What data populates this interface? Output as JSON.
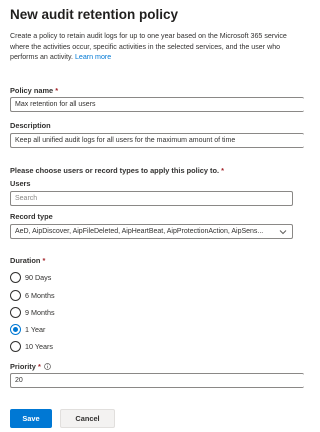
{
  "panel": {
    "title": "New audit retention policy",
    "description": "Create a policy to retain audit logs for up to one year based on the Microsoft 365 service where the activities occur, specific activities in the selected services, and the user who performs an activity.",
    "learn_more": "Learn more"
  },
  "form": {
    "policy_name": {
      "label": "Policy name",
      "required_mark": "*",
      "value": "Max retention for all users"
    },
    "description": {
      "label": "Description",
      "value": "Keep all unified audit logs for all users for the maximum amount of time"
    },
    "scope_heading": "Please choose users or record types to apply this policy to.",
    "scope_required_mark": "*",
    "users": {
      "label": "Users",
      "placeholder": "Search"
    },
    "record_type": {
      "label": "Record type",
      "value": "AeD, AipDiscover, AipFileDeleted, AipHeartBeat, AipProtectionAction, AipSens..."
    },
    "duration": {
      "label": "Duration",
      "required_mark": "*",
      "options": [
        {
          "label": "90 Days",
          "selected": false
        },
        {
          "label": "6 Months",
          "selected": false
        },
        {
          "label": "9 Months",
          "selected": false
        },
        {
          "label": "1 Year",
          "selected": true
        },
        {
          "label": "10 Years",
          "selected": false
        }
      ]
    },
    "priority": {
      "label": "Priority",
      "required_mark": "*",
      "value": "20"
    }
  },
  "actions": {
    "save_label": "Save",
    "cancel_label": "Cancel"
  },
  "colors": {
    "accent": "#0078d4",
    "required": "#a4262c",
    "border": "#8a8886"
  },
  "icons": {
    "chevron": "chevron-down-icon",
    "info": "info-icon"
  }
}
